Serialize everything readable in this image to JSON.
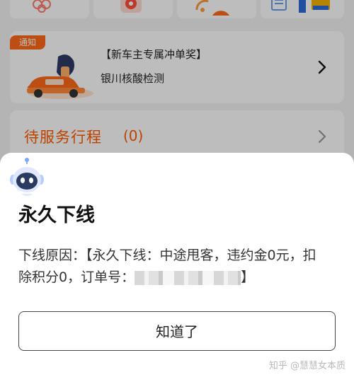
{
  "notice": {
    "tag": "通知",
    "title": "【新车主专属冲单奖】",
    "subtitle": "银川核酸检测"
  },
  "pending": {
    "title": "待服务行程",
    "count": "(0)"
  },
  "dialog": {
    "title": "永久下线",
    "reason_text": "下线原因：【永久下线：中途甩客，违约金0元，扣除积分0，订单号：",
    "reason_end": "】",
    "button_label": "知道了"
  },
  "watermark": "知乎 @慧慧女本质",
  "colors": {
    "accent": "#ff5a00",
    "tag_bg": "#ff6a1a",
    "overlay": "rgba(0,0,0,0.26)"
  },
  "icons": [
    "gift-icon",
    "medal-icon",
    "speed-gauge-icon",
    "document-icon",
    "chevron-right-icon",
    "robot-avatar-icon"
  ]
}
